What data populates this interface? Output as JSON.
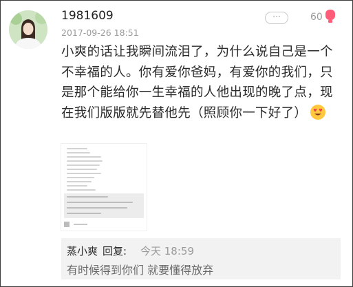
{
  "post": {
    "username": "1981609",
    "timestamp": "2017-09-26 18:51",
    "more_label": "···",
    "like_count": "60",
    "text": "小爽的话让我瞬间流泪了，为什么说自己是一个不幸福的人。你有爱你爸妈，有爱你的我们，只是那个能给你一生幸福的人他出现的晚了点，现在我们版版就先替他先（照顾你一下好了）",
    "emoji": "smiling-face-with-heart-eyes"
  },
  "reply": {
    "author": "蒸小爽",
    "label": "回复:",
    "time": "今天 18:59",
    "text": "有时候得到你们 就要懂得放弃"
  },
  "colors": {
    "like_accent": "#ff5c7a",
    "muted_text": "#9a9a9a",
    "reply_background": "#f2f2f2"
  }
}
